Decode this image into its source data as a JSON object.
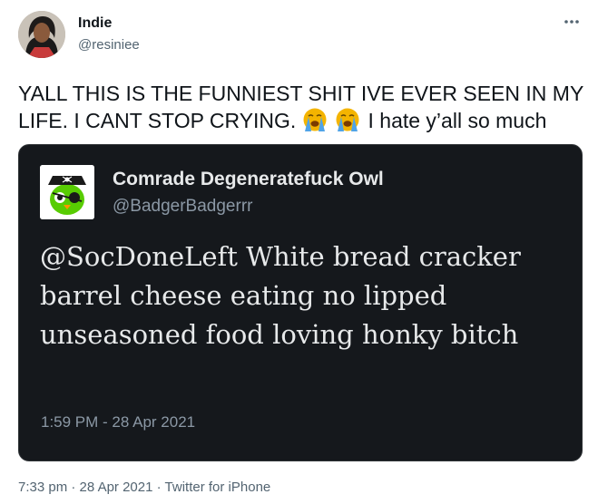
{
  "tweet": {
    "author": {
      "name": "Indie",
      "handle": "@resiniee"
    },
    "more_icon": "more-dots-icon",
    "text_main": "YALL THIS IS THE FUNNIEST SHIT IVE EVER SEEN IN MY LIFE. I CANT STOP CRYING.",
    "emoji": "loudly-crying-face-emoji",
    "text_tail": "I hate y’all so much",
    "timestamp": "7:33 pm",
    "separator": "·",
    "date": "28 Apr 2021",
    "source": "Twitter for iPhone"
  },
  "quoted": {
    "name": "Comrade Degeneratefuck Owl",
    "handle": "@BadgerBadgerrr",
    "text": "@SocDoneLeft White bread cracker barrel cheese eating no lipped unseasoned food loving honky bitch",
    "time": "1:59 PM - 28 Apr 2021",
    "card_bg": "#15181c"
  },
  "colors": {
    "text": "#0f1419",
    "secondary": "#536471",
    "card_text": "#e7e9ea",
    "card_secondary": "#8b98a5",
    "owl_green": "#58cc02"
  }
}
